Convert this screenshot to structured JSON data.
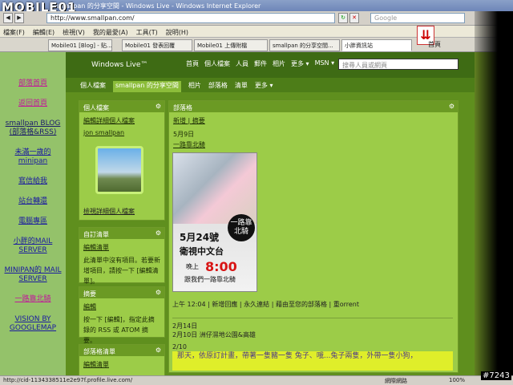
{
  "browser": {
    "logo": "MOBILE01",
    "title": "smallpan 的分享空間 - Windows Live - Windows Internet Explorer",
    "address": "http://www.smallpan.com/",
    "search_placeholder": "Google",
    "menu": [
      "檔案(F)",
      "編輯(E)",
      "檢視(V)",
      "我的最愛(A)",
      "工具(T)",
      "說明(H)"
    ],
    "tabs": [
      "Mobile01 [Blog] - 贴...",
      "Mobile01 發表回覆",
      "Mobile01 上傳附檔",
      "smallpan 的分享空間...",
      "小胖資訊站"
    ],
    "home_label": "首頁",
    "status_url": "http://cid-1134338511e2e97f.profile.live.com/",
    "status_right": "網際網路",
    "zoom": "100%"
  },
  "leftnav": {
    "links": [
      "部落首頁",
      "返回首頁",
      "smallpan BLOG (部落格&RSS)",
      "未滿一歲的 minipan",
      "寫信給我",
      "站台轉還",
      "電腦專區",
      "小胖的MAIL SERVER",
      "MINIPAN的 MAIL SERVER",
      "一路靠北騎",
      "VISION BY GOOGLEMAP"
    ]
  },
  "site": {
    "brand": "Windows Live™",
    "nav": [
      "首頁",
      "個人檔案",
      "人員",
      "郵件",
      "相片",
      "更多 ▾",
      "MSN ▾"
    ],
    "search_placeholder": "搜尋人員或網頁",
    "subnav": [
      "個人檔案",
      "smallpan 的分享空間",
      "相片",
      "部落格",
      "清單",
      "更多 ▾"
    ]
  },
  "profile_panel": {
    "title": "個人檔案",
    "edit": "編輯詳細個人檔案",
    "username": "jon smallpan",
    "view": "檢視詳細個人檔案"
  },
  "custom_list": {
    "title": "自訂清單",
    "edit": "編輯清單",
    "text": "此清單中沒有項目。若要新增項目，請按一下 [編輯清單]。"
  },
  "summary": {
    "title": "摘要",
    "edit": "編輯",
    "text": "按一下 [編輯]，指定此摘錄的 RSS 或 ATOM 摘要。"
  },
  "blog_list": {
    "title": "部落格清單",
    "edit": "編輯清單"
  },
  "blog": {
    "title": "部落格",
    "actions": "新增 | 摘要",
    "date": "5月9日",
    "post_title": "一路靠北騎",
    "poster": {
      "badge": "一路靠北騎",
      "line1": "5月24號",
      "line2": "衛視中文台",
      "time_prefix": "晚上",
      "time": "8:00",
      "line4": "跟我們一路靠北騎"
    },
    "footer": "上午 12:04 | 新增回應 | 永久連結 | 藉由至您的部落格 | 重orrent",
    "date2": "2月14日",
    "post2": "2月10日 洲仔濕地公園&高雄",
    "date3": "2/10",
    "highlight": "那天，依原訂計畫，帶著一隻豬一隻 兔子、哦...兔子兩隻，外帶一隻小狗，"
  },
  "watermark": "#7243"
}
